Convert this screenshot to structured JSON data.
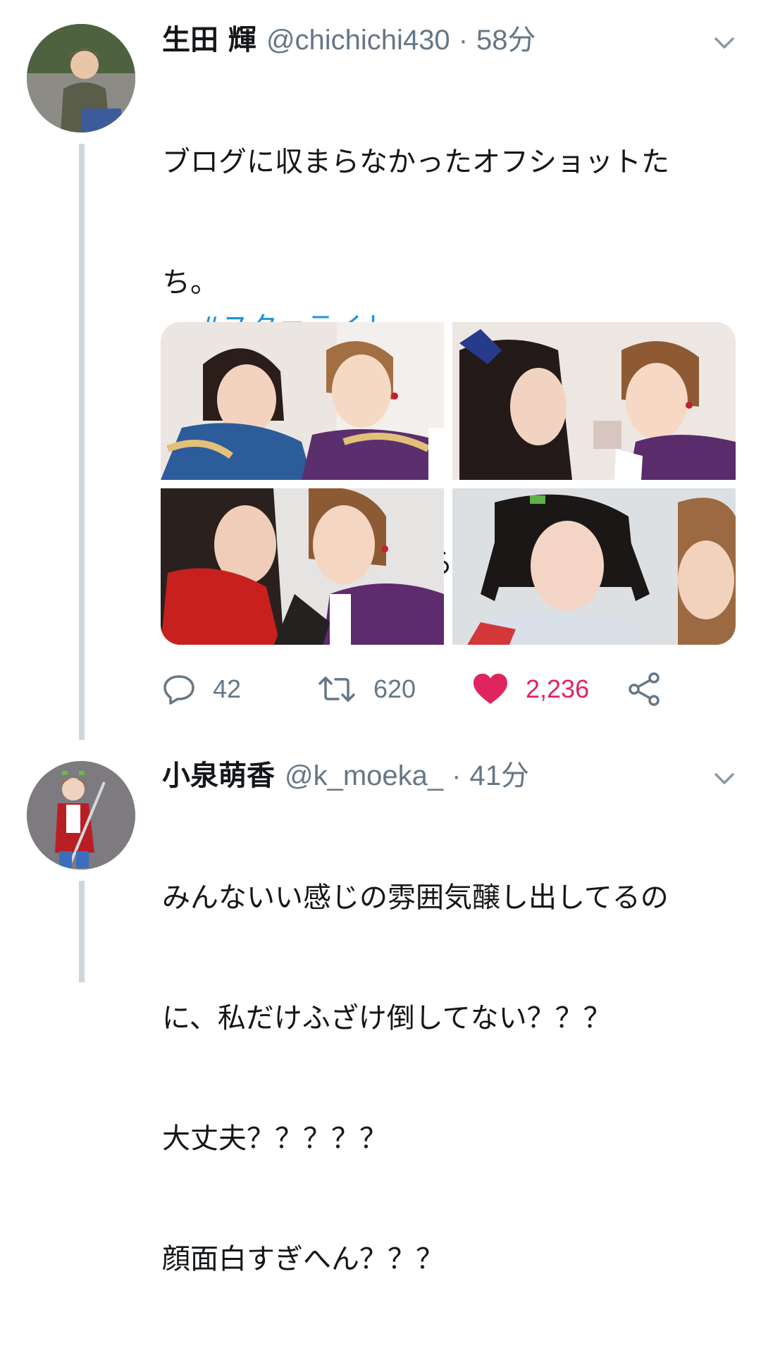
{
  "tweets": [
    {
      "author_name": "生田 輝",
      "handle": "@chichichi430",
      "separator": "·",
      "time": "58分",
      "text_lines": [
        "ブログに収まらなかったオフショットた",
        "ち。",
        "",
        "みつめてる いくたてる シリーズ✨笑"
      ],
      "hashtag": "#スタァライト",
      "photos": [
        "photo-1",
        "photo-2",
        "photo-3",
        "photo-4"
      ],
      "actions": {
        "reply_count": "42",
        "retweet_count": "620",
        "like_count": "2,236"
      }
    },
    {
      "author_name": "小泉萌香",
      "handle": "@k_moeka_",
      "separator": "·",
      "time": "41分",
      "text_lines": [
        "みんないい感じの雰囲気醸し出してるの",
        "に、私だけふざけ倒してない？？？",
        "大丈夫？？？？？",
        "顔面白すぎへん？？？"
      ]
    }
  ],
  "colors": {
    "link": "#1b95e0",
    "like": "#e0245e",
    "muted": "#657786",
    "thread_line": "#ccd6dd"
  },
  "icons": [
    "chevron-down-icon",
    "reply-icon",
    "retweet-icon",
    "heart-icon",
    "share-icon",
    "sparkles-emoji"
  ]
}
